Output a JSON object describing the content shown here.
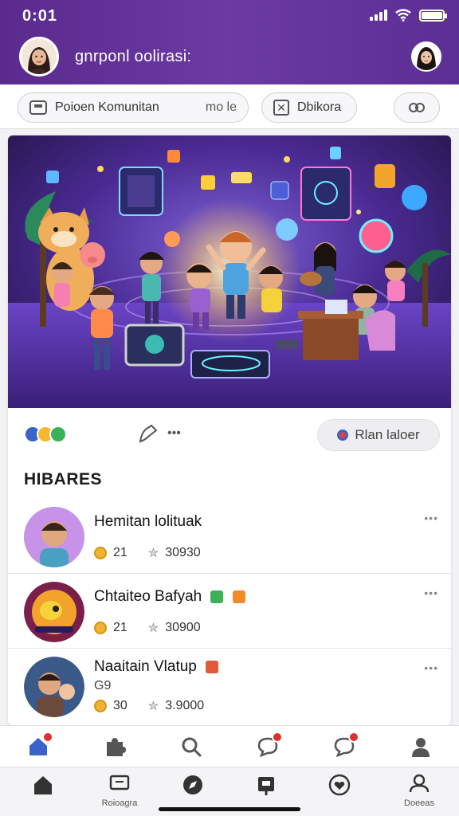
{
  "status_bar": {
    "time": "0:01"
  },
  "header": {
    "title": "gnrponl oolirasi:"
  },
  "chips": [
    {
      "label": "Poioen Komunitan",
      "trailing": "mo le"
    },
    {
      "label": "Dbikora"
    },
    {
      "label": ""
    }
  ],
  "post": {
    "action_button": "Rlan laloer",
    "share_dots": "•••"
  },
  "section": {
    "title": "HIBARES"
  },
  "items": [
    {
      "title": "Hemitan lolituak",
      "subtitle": "",
      "coins": "21",
      "stars": "30930",
      "more": "•••"
    },
    {
      "title": "Chtaiteo Bafyah",
      "subtitle": "",
      "coins": "21",
      "stars": "30900",
      "more": "•••"
    },
    {
      "title": "Naaitain Vlatup",
      "subtitle": "G9",
      "coins": "30",
      "stars": "3.9000",
      "more": "•••"
    }
  ],
  "bottom_nav": {
    "labels": [
      "",
      "Roioagra",
      "",
      "",
      "",
      "Doeeas"
    ]
  },
  "colors": {
    "header_bg": "#5a2a8e",
    "accent_blue": "#3a63c9",
    "badge_red": "#e0302e"
  },
  "icons": [
    "home-icon",
    "puzzle-icon",
    "search-icon",
    "chat-icon",
    "message-icon",
    "person-icon"
  ]
}
